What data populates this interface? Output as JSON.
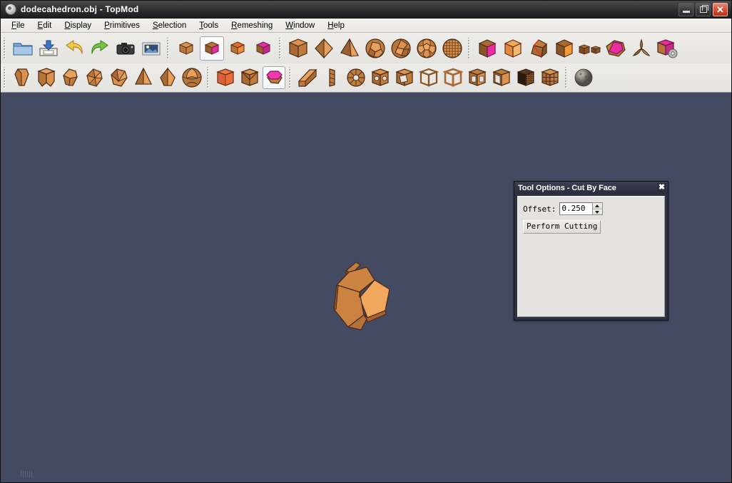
{
  "window": {
    "title": "dodecahedron.obj - TopMod",
    "app_icon": "topmod-logo-icon",
    "minimize_label": "–",
    "maximize_label": "❐",
    "close_label": "✕"
  },
  "menubar": {
    "items": [
      {
        "label": "File",
        "mnemonic": "F"
      },
      {
        "label": "Edit",
        "mnemonic": "E"
      },
      {
        "label": "Display",
        "mnemonic": "D"
      },
      {
        "label": "Primitives",
        "mnemonic": "P"
      },
      {
        "label": "Selection",
        "mnemonic": "S"
      },
      {
        "label": "Tools",
        "mnemonic": "T"
      },
      {
        "label": "Remeshing",
        "mnemonic": "R"
      },
      {
        "label": "Window",
        "mnemonic": "W"
      },
      {
        "label": "Help",
        "mnemonic": "H"
      }
    ]
  },
  "toolbar_row1": {
    "groups": [
      {
        "name": "file-group",
        "tools": [
          {
            "icon": "open-folder-icon",
            "label": "Open",
            "selected": false
          },
          {
            "icon": "save-disk-icon",
            "label": "Save",
            "selected": false
          },
          {
            "icon": "undo-arrow-icon",
            "label": "Undo",
            "selected": false
          },
          {
            "icon": "redo-arrow-icon",
            "label": "Redo",
            "selected": false
          },
          {
            "icon": "camera-icon",
            "label": "Screenshot",
            "selected": false
          },
          {
            "icon": "image-frame-icon",
            "label": "Load Image",
            "selected": false
          }
        ]
      },
      {
        "name": "mode-group",
        "tools": [
          {
            "icon": "cube-orange-icon",
            "label": "Basics Mode",
            "selected": false
          },
          {
            "icon": "cube-magenta-icon",
            "label": "Extrusion Mode",
            "selected": true
          },
          {
            "icon": "cube-red-icon",
            "label": "Conical Mode",
            "selected": false
          },
          {
            "icon": "cube-pink-icon",
            "label": "Remeshing Mode",
            "selected": false
          }
        ]
      },
      {
        "name": "primitives-group",
        "tools": [
          {
            "icon": "cube-primitive-icon",
            "label": "Cube",
            "selected": false
          },
          {
            "icon": "octahedron-primitive-icon",
            "label": "Octahedron",
            "selected": false
          },
          {
            "icon": "tetrahedron-primitive-icon",
            "label": "Tetrahedron",
            "selected": false
          },
          {
            "icon": "dodecahedron-primitive-icon",
            "label": "Dodecahedron",
            "selected": false
          },
          {
            "icon": "icosahedron-primitive-icon",
            "label": "Icosahedron",
            "selected": false
          },
          {
            "icon": "soccerball-primitive-icon",
            "label": "Soccer Ball",
            "selected": false
          },
          {
            "icon": "geodesic-sphere-primitive-icon",
            "label": "Geodesic Sphere",
            "selected": false
          }
        ]
      },
      {
        "name": "operations-group",
        "tools": [
          {
            "icon": "cube-face-magenta-icon",
            "label": "Insert Edge",
            "selected": false
          },
          {
            "icon": "cube-subdivide-icon",
            "label": "Subdivide Edge",
            "selected": false
          },
          {
            "icon": "cube-collapse-icon",
            "label": "Collapse Edge",
            "selected": false
          },
          {
            "icon": "cube-split-valence-icon",
            "label": "Split Valence",
            "selected": false
          },
          {
            "icon": "cube-pair-icon",
            "label": "Connect Faces",
            "selected": false
          },
          {
            "icon": "dodeca-magenta-icon",
            "label": "Transform",
            "selected": false
          },
          {
            "icon": "tripod-icon",
            "label": "Handles",
            "selected": false
          },
          {
            "icon": "cube-gear-icon",
            "label": "Settings",
            "selected": false
          }
        ]
      }
    ]
  },
  "toolbar_row2": {
    "groups": [
      {
        "name": "extrusion-group",
        "tools": [
          {
            "icon": "extrude-doo-sabin-icon",
            "label": "Doo Sabin Extrude",
            "selected": false
          },
          {
            "icon": "extrude-cubical-icon",
            "label": "Cubical Extrude",
            "selected": false
          },
          {
            "icon": "extrude-dodeca-icon",
            "label": "Dodecahedral Extrude",
            "selected": false
          },
          {
            "icon": "extrude-icosa-icon",
            "label": "Icosahedral Extrude",
            "selected": false
          },
          {
            "icon": "extrude-octahedral-icon",
            "label": "Octahedral Extrude",
            "selected": false
          },
          {
            "icon": "extrude-stellate-icon",
            "label": "Stellate",
            "selected": false
          },
          {
            "icon": "extrude-double-stellate-icon",
            "label": "Double Stellate",
            "selected": false
          },
          {
            "icon": "extrude-dome-icon",
            "label": "Domed Extrude",
            "selected": false
          }
        ]
      },
      {
        "name": "cutting-group",
        "tools": [
          {
            "icon": "cut-by-edge-icon",
            "label": "Cut By Edge",
            "selected": false
          },
          {
            "icon": "cut-by-vertex-icon",
            "label": "Cut By Vertex",
            "selected": false
          },
          {
            "icon": "cut-by-face-icon",
            "label": "Cut By Face",
            "selected": true
          }
        ]
      },
      {
        "name": "remeshing-group",
        "tools": [
          {
            "icon": "remesh-wedge-icon",
            "label": "Wedge Remesh",
            "selected": false
          },
          {
            "icon": "remesh-column-icon",
            "label": "Column Remesh",
            "selected": false
          },
          {
            "icon": "remesh-spiral-icon",
            "label": "Spiral Remesh",
            "selected": false
          },
          {
            "icon": "remesh-corner-cut-icon",
            "label": "Corner Cutting",
            "selected": false
          },
          {
            "icon": "remesh-corner-open-icon",
            "label": "Corner Open",
            "selected": false
          },
          {
            "icon": "remesh-wire-frame-icon",
            "label": "Wireframe Modeling",
            "selected": false
          },
          {
            "icon": "remesh-wire-frame2-icon",
            "label": "Wireframe Modeling 2",
            "selected": false
          },
          {
            "icon": "remesh-wire-cage-icon",
            "label": "Wire Cage",
            "selected": false
          },
          {
            "icon": "remesh-wire-open-icon",
            "label": "Open Wire",
            "selected": false
          },
          {
            "icon": "remesh-dense-icon",
            "label": "Dense Remesh",
            "selected": false
          },
          {
            "icon": "remesh-grid-icon",
            "label": "Grid Remesh",
            "selected": false
          }
        ]
      },
      {
        "name": "texturing-group",
        "tools": [
          {
            "icon": "rocky-sphere-icon",
            "label": "Texturing",
            "selected": false
          }
        ]
      }
    ]
  },
  "viewport": {
    "background_color": "#454a63",
    "model_name": "dodecahedron",
    "face_colors": [
      "#d98f4f",
      "#f2a95c",
      "#c77c3f",
      "#b8703a",
      "#e89c57"
    ],
    "edge_color": "#4a2a18"
  },
  "dialog": {
    "title": "Tool Options - Cut By Face",
    "close_label": "✖",
    "offset": {
      "label": "Offset:",
      "value": "0.250"
    },
    "perform_button": "Perform Cutting"
  }
}
